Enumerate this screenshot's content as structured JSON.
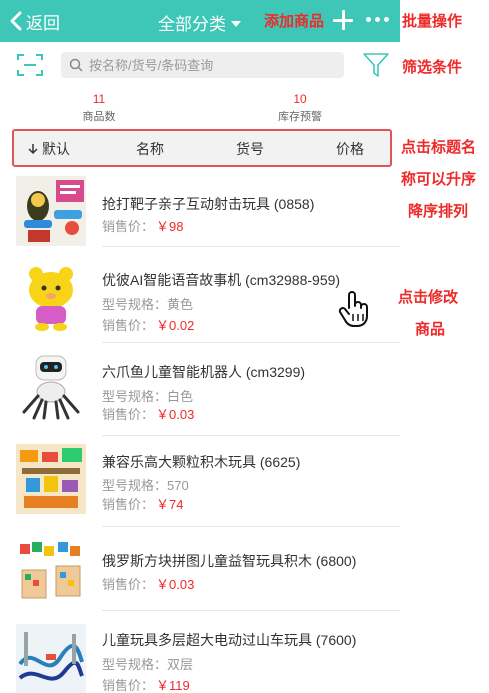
{
  "header": {
    "back_label": "返回",
    "category_label": "全部分类"
  },
  "annotations": {
    "add_product": "添加商品",
    "batch_ops": "批量操作",
    "filter": "筛选条件",
    "sort_line1": "点击标题名",
    "sort_line2": "称可以升序",
    "sort_line3": "降序排列",
    "edit_line1": "点击修改",
    "edit_line2": "商品"
  },
  "search": {
    "placeholder": "按名称/货号/条码查询"
  },
  "stats": {
    "product_count": "11",
    "product_count_label": "商品数",
    "stock_warning": "10",
    "stock_warning_label": "库存预警"
  },
  "sort": {
    "default": "默认",
    "name": "名称",
    "code": "货号",
    "price": "价格"
  },
  "labels": {
    "spec": "型号规格：",
    "price": "销售价："
  },
  "products": [
    {
      "name": "抢打靶子亲子互动射击玩具 (0858)",
      "spec": "",
      "price": "￥98"
    },
    {
      "name": "优彼AI智能语音故事机 (cm32988-959)",
      "spec": "黄色",
      "price": "￥0.02"
    },
    {
      "name": "六爪鱼儿童智能机器人 (cm3299)",
      "spec": "白色",
      "price": "￥0.03"
    },
    {
      "name": "兼容乐高大颗粒积木玩具 (6625)",
      "spec": "570",
      "price": "￥74"
    },
    {
      "name": "俄罗斯方块拼图儿童益智玩具积木 (6800)",
      "spec": "",
      "price": "￥0.03"
    },
    {
      "name": "儿童玩具多层超大电动过山车玩具 (7600)",
      "spec": "双层",
      "price": "￥119"
    }
  ]
}
